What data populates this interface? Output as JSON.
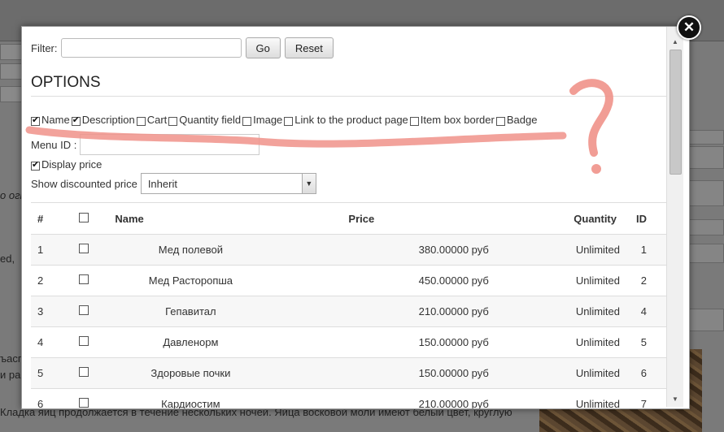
{
  "background": {
    "text_lines": [
      "ed,",
      "о огн",
      "ъасп",
      "и рак",
      "Кладка яиц продолжается в течение нескольких ночей. Яйца восковой моли имеют белый цвет, круглую"
    ]
  },
  "dialog": {
    "close_glyph": "✕",
    "filter": {
      "label": "Filter:",
      "value": "",
      "go_label": "Go",
      "reset_label": "Reset"
    },
    "options_title": "OPTIONS",
    "options": [
      {
        "label": "Name",
        "checked": true
      },
      {
        "label": "Description",
        "checked": true
      },
      {
        "label": "Cart",
        "checked": false
      },
      {
        "label": "Quantity field",
        "checked": false
      },
      {
        "label": "Image",
        "checked": false
      },
      {
        "label": "Link to the product page",
        "checked": false
      },
      {
        "label": "Item box border",
        "checked": false
      },
      {
        "label": "Badge",
        "checked": false
      }
    ],
    "menu_id": {
      "label": "Menu ID :",
      "value": ""
    },
    "display_price": {
      "label": "Display price",
      "checked": true
    },
    "discounted": {
      "label": "Show discounted price",
      "selected": "Inherit"
    },
    "table": {
      "headers": {
        "num": "#",
        "name": "Name",
        "price": "Price",
        "quantity": "Quantity",
        "id": "ID"
      },
      "rows": [
        {
          "num": "1",
          "name": "Мед полевой",
          "price": "380.00000 руб",
          "quantity": "Unlimited",
          "id": "1"
        },
        {
          "num": "2",
          "name": "Мед Расторопша",
          "price": "450.00000 руб",
          "quantity": "Unlimited",
          "id": "2"
        },
        {
          "num": "3",
          "name": "Гепавитал",
          "price": "210.00000 руб",
          "quantity": "Unlimited",
          "id": "4"
        },
        {
          "num": "4",
          "name": "Давленорм",
          "price": "150.00000 руб",
          "quantity": "Unlimited",
          "id": "5"
        },
        {
          "num": "5",
          "name": "Здоровые почки",
          "price": "150.00000 руб",
          "quantity": "Unlimited",
          "id": "6"
        },
        {
          "num": "6",
          "name": "Кардиостим",
          "price": "210.00000 руб",
          "quantity": "Unlimited",
          "id": "7"
        }
      ]
    }
  },
  "annotation": {
    "glyph": "?",
    "color": "#f0928a"
  },
  "icons": {
    "close": "close-icon",
    "scroll_up": "scroll-up-icon",
    "scroll_down": "scroll-down-icon",
    "dropdown": "chevron-down-icon"
  }
}
